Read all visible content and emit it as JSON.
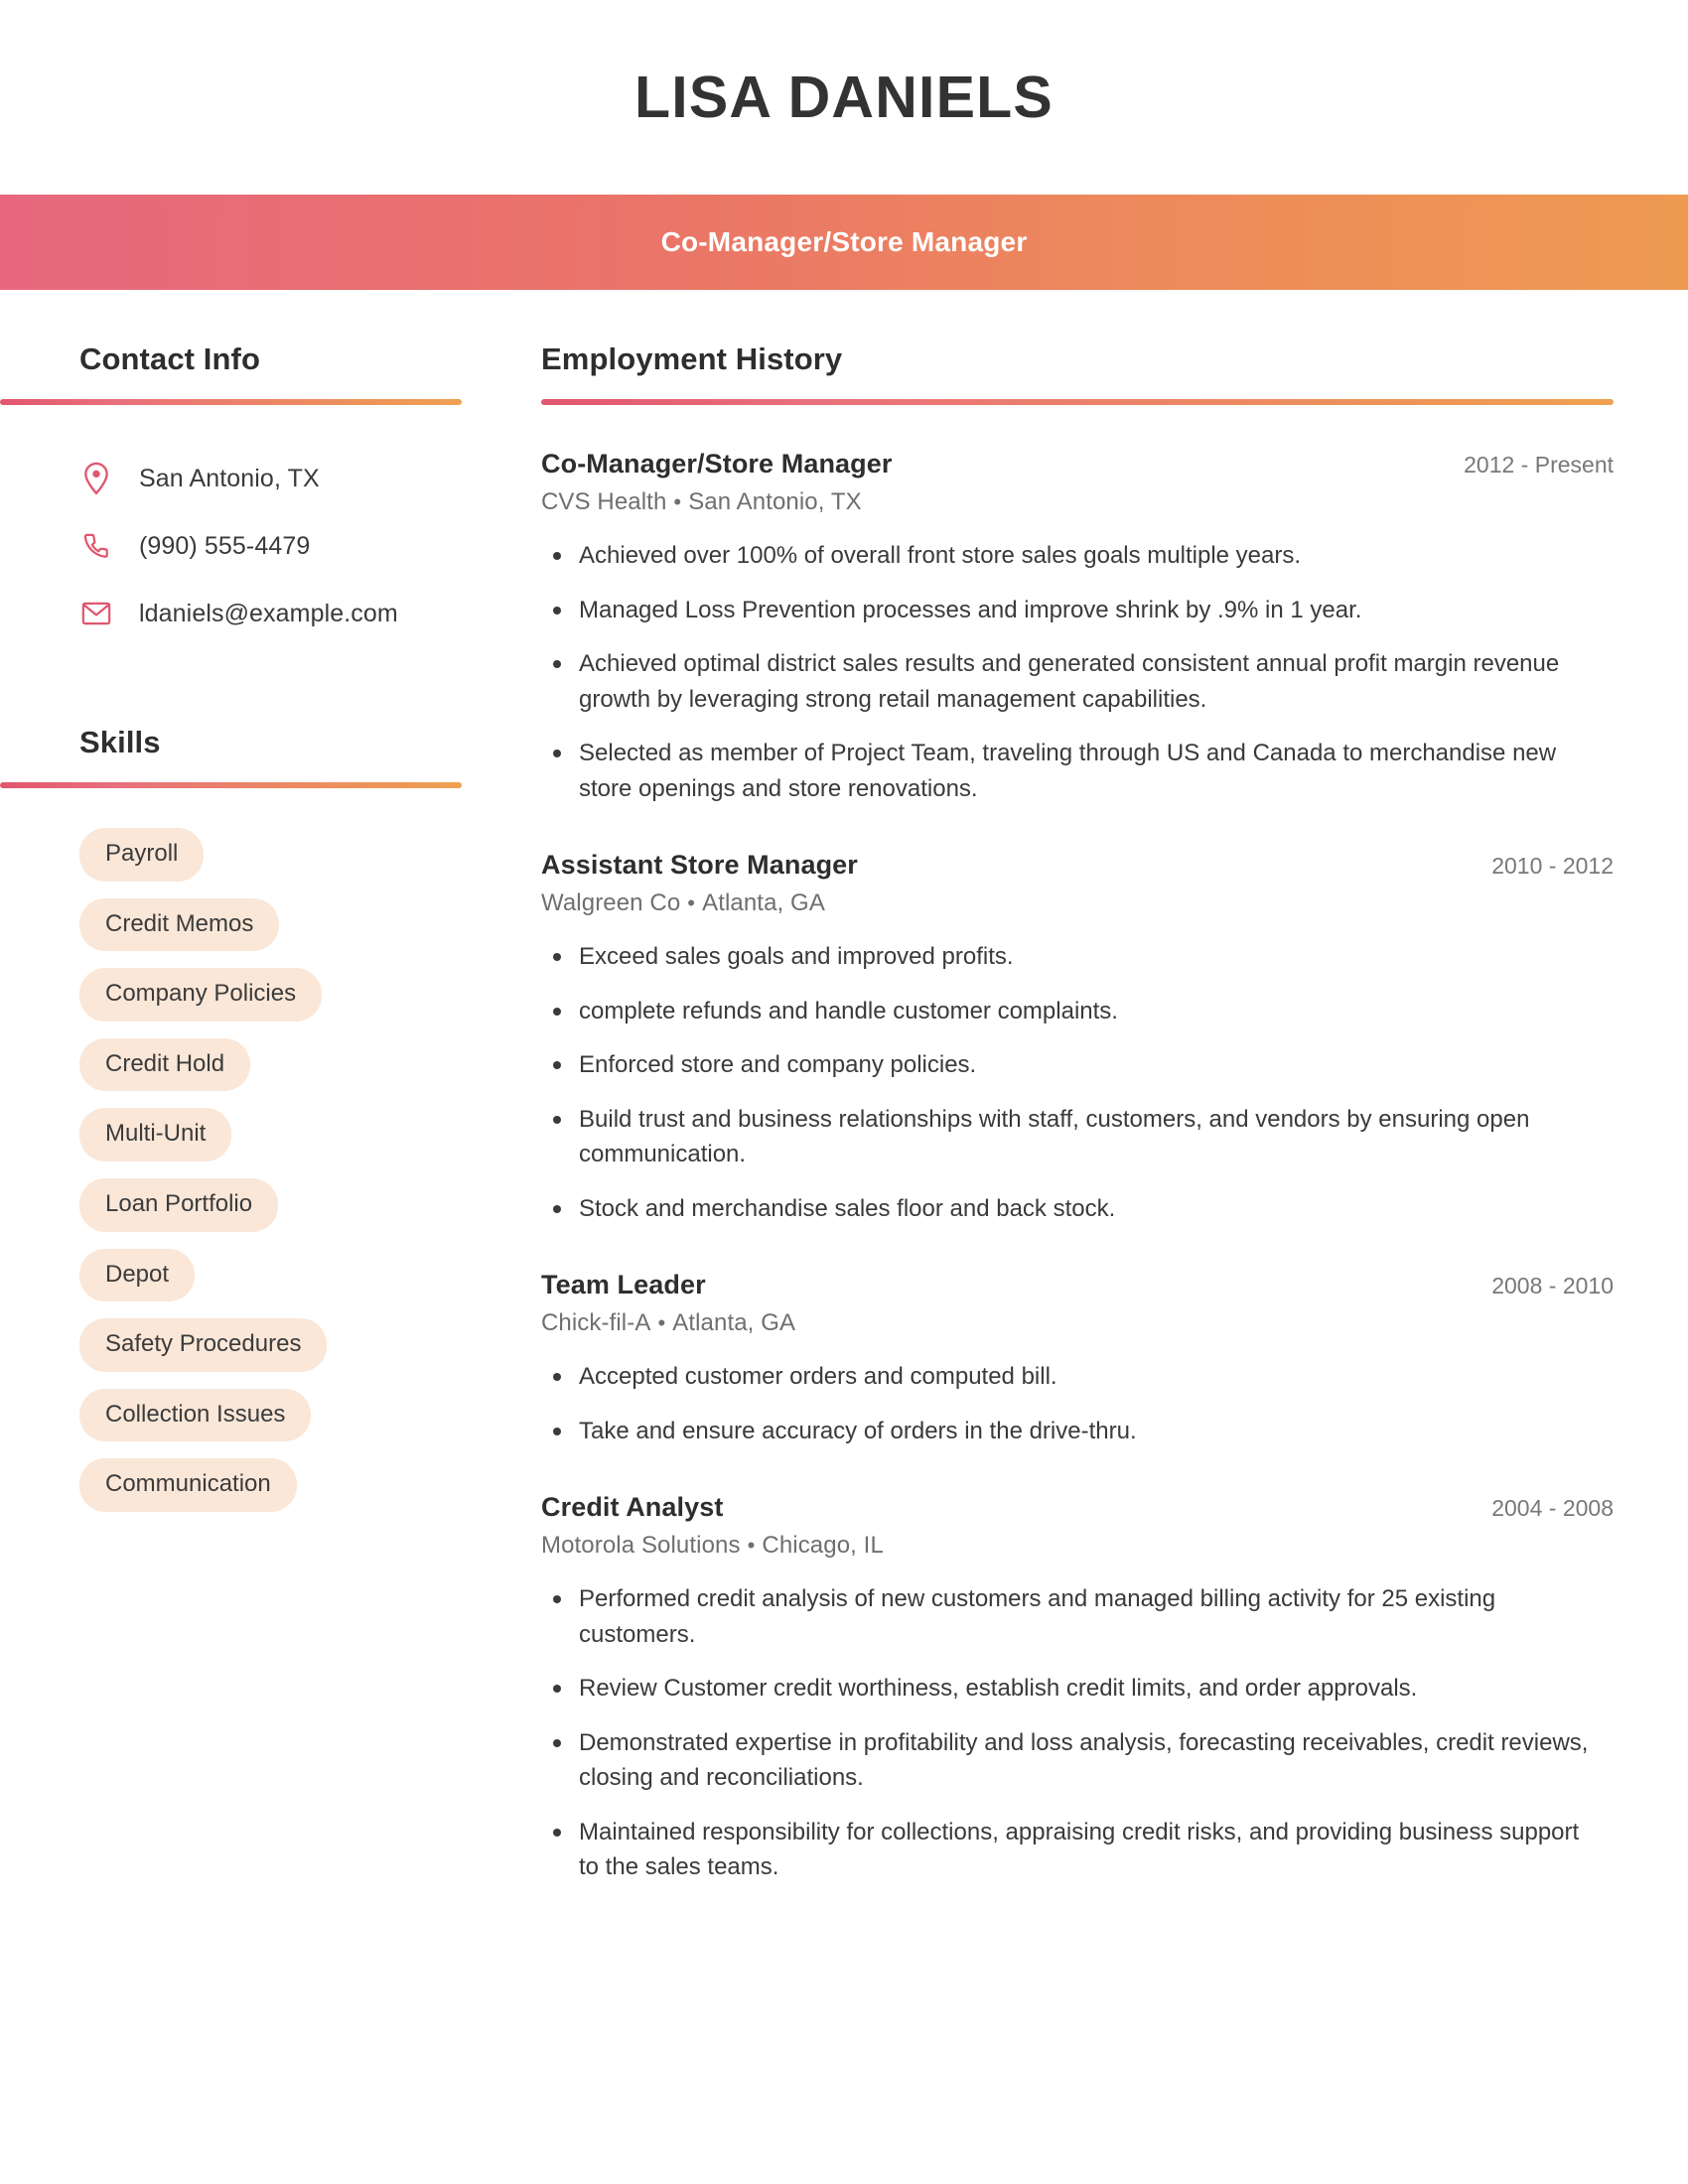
{
  "header": {
    "name": "LISA DANIELS",
    "title_band": "Co-Manager/Store Manager",
    "colors": {
      "gradient_start": "#E8677E",
      "gradient_end": "#EE9A52",
      "icon": "#DE566E",
      "pill_bg": "#FAE7D8",
      "heading": "#2E2E2E"
    }
  },
  "sidebar": {
    "contact": {
      "heading": "Contact Info",
      "items": [
        {
          "icon": "location-pin-icon",
          "text": "San Antonio, TX"
        },
        {
          "icon": "phone-icon",
          "text": "(990) 555-4479"
        },
        {
          "icon": "envelope-icon",
          "text": "ldaniels@example.com"
        }
      ]
    },
    "skills": {
      "heading": "Skills",
      "items": [
        "Payroll",
        "Credit Memos",
        "Company Policies",
        "Credit Hold",
        "Multi-Unit",
        "Loan Portfolio",
        "Depot",
        "Safety Procedures",
        "Collection Issues",
        "Communication"
      ]
    }
  },
  "main": {
    "heading": "Employment History",
    "separator": "•",
    "jobs": [
      {
        "title": "Co-Manager/Store Manager",
        "dates": "2012 - Present",
        "company": "CVS Health",
        "location": "San Antonio, TX",
        "bullets": [
          "Achieved over 100% of overall front store sales goals multiple years.",
          "Managed Loss Prevention processes and improve shrink by .9% in 1 year.",
          "Achieved optimal district sales results and generated consistent annual profit margin revenue growth by leveraging strong retail management capabilities.",
          "Selected as member of Project Team, traveling through US and Canada to merchandise new store openings and store renovations."
        ]
      },
      {
        "title": "Assistant Store Manager",
        "dates": "2010 - 2012",
        "company": "Walgreen Co",
        "location": "Atlanta, GA",
        "bullets": [
          "Exceed sales goals and improved profits.",
          "complete refunds and handle customer complaints.",
          "Enforced store and company policies.",
          "Build trust and business relationships with staff, customers, and vendors by ensuring open communication.",
          "Stock and merchandise sales floor and back stock."
        ]
      },
      {
        "title": "Team Leader",
        "dates": "2008 - 2010",
        "company": "Chick-fil-A",
        "location": "Atlanta, GA",
        "bullets": [
          "Accepted customer orders and computed bill.",
          "Take and ensure accuracy of orders in the drive-thru."
        ]
      },
      {
        "title": "Credit Analyst",
        "dates": "2004 - 2008",
        "company": "Motorola Solutions",
        "location": "Chicago, IL",
        "bullets": [
          "Performed credit analysis of new customers and managed billing activity for 25 existing customers.",
          "Review Customer credit worthiness, establish credit limits, and order approvals.",
          "Demonstrated expertise in profitability and loss analysis, forecasting receivables, credit reviews, closing and reconciliations.",
          "Maintained responsibility for collections, appraising credit risks, and providing business support to the sales teams."
        ]
      }
    ]
  }
}
